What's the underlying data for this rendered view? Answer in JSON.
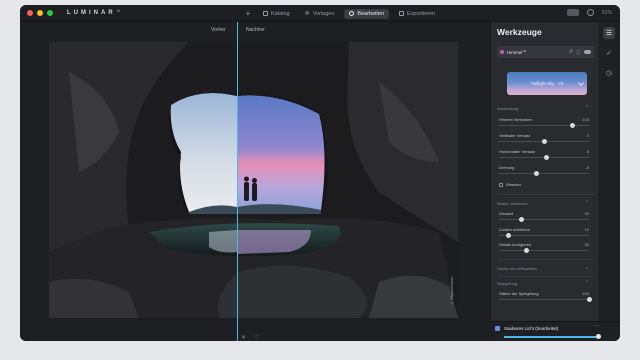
{
  "app": {
    "name": "LUMINAR",
    "version": "AI"
  },
  "nav": {
    "plus": "+",
    "items": [
      {
        "label": "Katalog"
      },
      {
        "label": "Vorlagen"
      },
      {
        "label": "Bearbeiten",
        "active": true
      },
      {
        "label": "Exportieren"
      }
    ]
  },
  "topbar_right": {
    "zoom": "61%"
  },
  "compare": {
    "before": "Vorher",
    "after": "Nachher"
  },
  "photo": {
    "credit": "© Skylum/Lizenz"
  },
  "panel": {
    "title": "Werkzeuge",
    "tool": {
      "name": "Himmel",
      "badge": "AI"
    },
    "sky_selection": "Twilight Sky - 24",
    "sections": {
      "ausrichtung": "Ausrichtung",
      "maske": "Maske verfeinern",
      "szene": "Szene neu beleuchten",
      "spiegelung": "Spiegelung"
    },
    "sliders": [
      {
        "label": "Himmel Verbinden",
        "value": "105",
        "pos": 0.82
      },
      {
        "label": "Vertikaler Versatz",
        "value": "0",
        "pos": 0.5
      },
      {
        "label": "Horizontaler Versatz",
        "value": "6",
        "pos": 0.53
      },
      {
        "label": "Drehung",
        "value": "-5",
        "pos": 0.42
      },
      {
        "label": "Gesamt",
        "value": "25",
        "pos": 0.25
      },
      {
        "label": "Lücken schließen",
        "value": "10",
        "pos": 0.1
      },
      {
        "label": "Details korrigieren",
        "value": "30",
        "pos": 0.3
      },
      {
        "label": "Stärke der Spiegelung",
        "value": "100",
        "pos": 1.0
      }
    ],
    "flip_label": "Wenden"
  },
  "preset": {
    "name": "Sauberes Licht (bearbeitet)",
    "more": "···"
  },
  "colors": {
    "accent": "#4fb6e6",
    "dot_close": "#ff5f57",
    "dot_min": "#febc2e",
    "dot_max": "#28c840",
    "sky_swatch": "#c45ab6"
  },
  "icons": {
    "rail": [
      "sliders-icon",
      "brush-icon",
      "history-icon"
    ],
    "bottom": [
      "close-icon",
      "heart-icon"
    ]
  }
}
